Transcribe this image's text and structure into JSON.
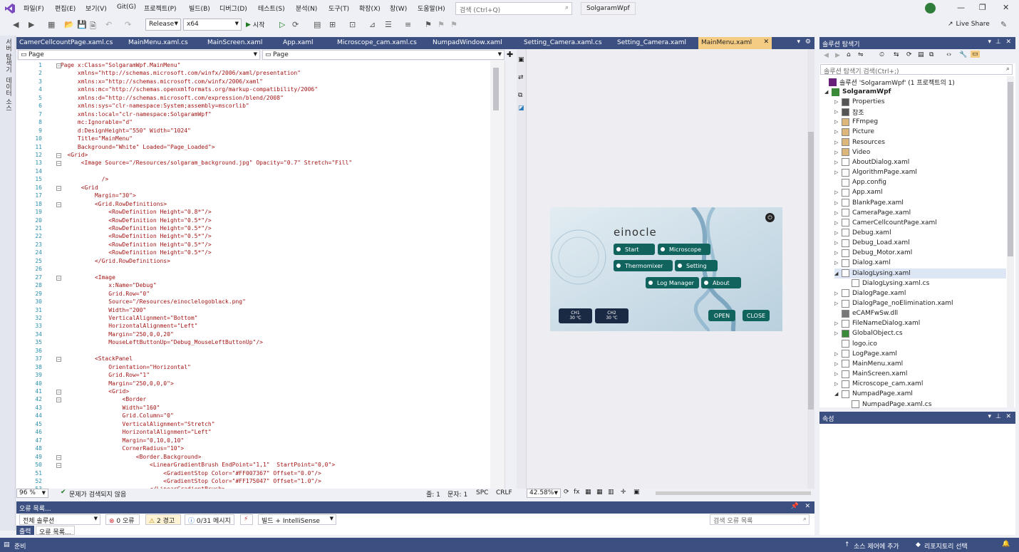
{
  "menu": {
    "items": [
      "파일(F)",
      "편집(E)",
      "보기(V)",
      "Git(G)",
      "프로젝트(P)",
      "빌드(B)",
      "디버그(D)",
      "테스트(S)",
      "분석(N)",
      "도구(T)",
      "확장(X)",
      "창(W)",
      "도움말(H)"
    ],
    "search_placeholder": "검색 (Ctrl+Q)",
    "solution_name": "SolgaramWpf"
  },
  "toolbar": {
    "config": "Release",
    "platform": "x64",
    "start_label": "시작",
    "live_share": "Live Share"
  },
  "left_rail": {
    "items": [
      "서버 탐색기",
      "데이터 소스"
    ]
  },
  "doc_tabs": [
    "CamerCellcountPage.xaml.cs",
    "MainMenu.xaml.cs",
    "MainScreen.xaml",
    "App.xaml",
    "Microscope_cam.xaml.cs",
    "NumpadWindow.xaml",
    "Setting_Camera.xaml.cs",
    "Setting_Camera.xaml",
    "MainMenu.xaml"
  ],
  "navbar": {
    "left": "Page",
    "right": "Page"
  },
  "code_lines": [
    "<Page x:Class=\"SolgaramWpf.MainMenu\"",
    "      xmlns=\"http://schemas.microsoft.com/winfx/2006/xaml/presentation\"",
    "      xmlns:x=\"http://schemas.microsoft.com/winfx/2006/xaml\"",
    "      xmlns:mc=\"http://schemas.openxmlformats.org/markup-compatibility/2006\"",
    "      xmlns:d=\"http://schemas.microsoft.com/expression/blend/2008\"",
    "      xmlns:sys=\"clr-namespace:System;assembly=mscorlib\"",
    "      xmlns:local=\"clr-namespace:SolgaramWpf\"",
    "      mc:Ignorable=\"d\"",
    "      d:DesignHeight=\"550\" Width=\"1024\"",
    "      Title=\"MainMenu\"",
    "      Background=\"White\" Loaded=\"Page_Loaded\">",
    "   <Grid>",
    "       <Image Source=\"/Resources/solgaram_background.jpg\" Opacity=\"0.7\" Stretch=\"Fill\"",
    "",
    "             />",
    "       <Grid",
    "           Margin=\"30\">",
    "           <Grid.RowDefinitions>",
    "               <RowDefinition Height=\"0.8*\"/>",
    "               <RowDefinition Height=\"0.5*\"/>",
    "               <RowDefinition Height=\"0.5*\"/>",
    "               <RowDefinition Height=\"0.5*\"/>",
    "               <RowDefinition Height=\"0.5*\"/>",
    "               <RowDefinition Height=\"0.5*\"/>",
    "           </Grid.RowDefinitions>",
    "",
    "           <Image",
    "               x:Name=\"Debug\"",
    "               Grid.Row=\"0\"",
    "               Source=\"/Resources/einoclelogoblack.png\"",
    "               Width=\"200\"",
    "               VerticalAlignment=\"Bottom\"",
    "               HorizontalAlignment=\"Left\"",
    "               Margin=\"250,0,0,20\"",
    "               MouseLeftButtonUp=\"Debug_MouseLeftButtonUp\"/>",
    "",
    "           <StackPanel",
    "               Orientation=\"Horizontal\"",
    "               Grid.Row=\"1\"",
    "               Margin=\"250,0,0,0\">",
    "               <Grid>",
    "                   <Border",
    "                   Width=\"160\"",
    "                   Grid.Column=\"0\"",
    "                   VerticalAlignment=\"Stretch\"",
    "                   HorizontalAlignment=\"Left\"",
    "                   Margin=\"0,10,0,10\"",
    "                   CornerRadius=\"10\">",
    "                       <Border.Background>",
    "                           <LinearGradientBrush EndPoint=\"1,1\"  StartPoint=\"0,0\">",
    "                               <GradientStop Color=\"#FF007367\" Offset=\"0.0\"/>",
    "                               <GradientStop Color=\"#FF175047\" Offset=\"1.0\"/>",
    "                           </LinearGradientBrush>"
  ],
  "editor_status": {
    "zoom": "96 %",
    "issues": "문제가 검색되지 않음",
    "line": "줄: 1",
    "char": "문자: 1",
    "spc": "SPC",
    "crlf": "CRLF"
  },
  "designer": {
    "logo": "einocle",
    "buttons": [
      "Start",
      "Microscope",
      "Thermomixer",
      "Setting",
      "Log Manager",
      "About"
    ],
    "ch1_label": "CH1",
    "ch1_value": "30 ℃",
    "ch2_label": "CH2",
    "ch2_value": "30 ℃",
    "open": "OPEN",
    "close": "CLOSE",
    "zoom": "42.58%"
  },
  "error_list": {
    "title": "오류 목록...",
    "scope": "전체 솔루션",
    "errors": "0 오류",
    "warnings": "2 경고",
    "messages": "0/31 메시지",
    "build": "빌드 + IntelliSense",
    "search_placeholder": "검색 오류 목록",
    "tabs": [
      "출력",
      "오류 목록..."
    ]
  },
  "solution_explorer": {
    "title": "솔루션 탐색기",
    "search_placeholder": "솔루션 탐색기 검색(Ctrl+;)",
    "root": "솔루션 'SolgaramWpf' (1 프로젝트의 1)",
    "project": "SolgaramWpf",
    "items": [
      {
        "label": "Properties",
        "icon": "wrench"
      },
      {
        "label": "참조",
        "icon": "ref"
      },
      {
        "label": "FFmpeg",
        "icon": "folder"
      },
      {
        "label": "Picture",
        "icon": "folder"
      },
      {
        "label": "Resources",
        "icon": "folder"
      },
      {
        "label": "Video",
        "icon": "folder"
      },
      {
        "label": "AboutDialog.xaml",
        "icon": "file"
      },
      {
        "label": "AlgorithmPage.xaml",
        "icon": "file"
      },
      {
        "label": "App.config",
        "icon": "file"
      },
      {
        "label": "App.xaml",
        "icon": "file"
      },
      {
        "label": "BlankPage.xaml",
        "icon": "file"
      },
      {
        "label": "CameraPage.xaml",
        "icon": "file"
      },
      {
        "label": "CamerCellcountPage.xaml",
        "icon": "file"
      },
      {
        "label": "Debug.xaml",
        "icon": "file"
      },
      {
        "label": "Debug_Load.xaml",
        "icon": "file"
      },
      {
        "label": "Debug_Motor.xaml",
        "icon": "file"
      },
      {
        "label": "Dialog.xaml",
        "icon": "file"
      },
      {
        "label": "DialogLysing.xaml",
        "icon": "file"
      },
      {
        "label": "DialogLysing.xaml.cs",
        "icon": "file"
      },
      {
        "label": "DialogPage.xaml",
        "icon": "file"
      },
      {
        "label": "DialogPage_noElimination.xaml",
        "icon": "file"
      },
      {
        "label": "eCAMFwSw.dll",
        "icon": "dll"
      },
      {
        "label": "FileNameDialog.xaml",
        "icon": "file"
      },
      {
        "label": "GlobalObject.cs",
        "icon": "cs"
      },
      {
        "label": "logo.ico",
        "icon": "file"
      },
      {
        "label": "LogPage.xaml",
        "icon": "file"
      },
      {
        "label": "MainMenu.xaml",
        "icon": "file"
      },
      {
        "label": "MainScreen.xaml",
        "icon": "file"
      },
      {
        "label": "Microscope_cam.xaml",
        "icon": "file"
      },
      {
        "label": "NumpadPage.xaml",
        "icon": "file"
      },
      {
        "label": "NumpadPage.xaml.cs",
        "icon": "file"
      }
    ]
  },
  "properties": {
    "title": "속성"
  },
  "status": {
    "ready": "준비",
    "source_control": "소스 제어에 추가",
    "repo": "리포지토리 선택"
  },
  "colors": {
    "accent": "#3b4f81",
    "active_tab": "#f5cc84",
    "button_teal": "#11635e"
  }
}
